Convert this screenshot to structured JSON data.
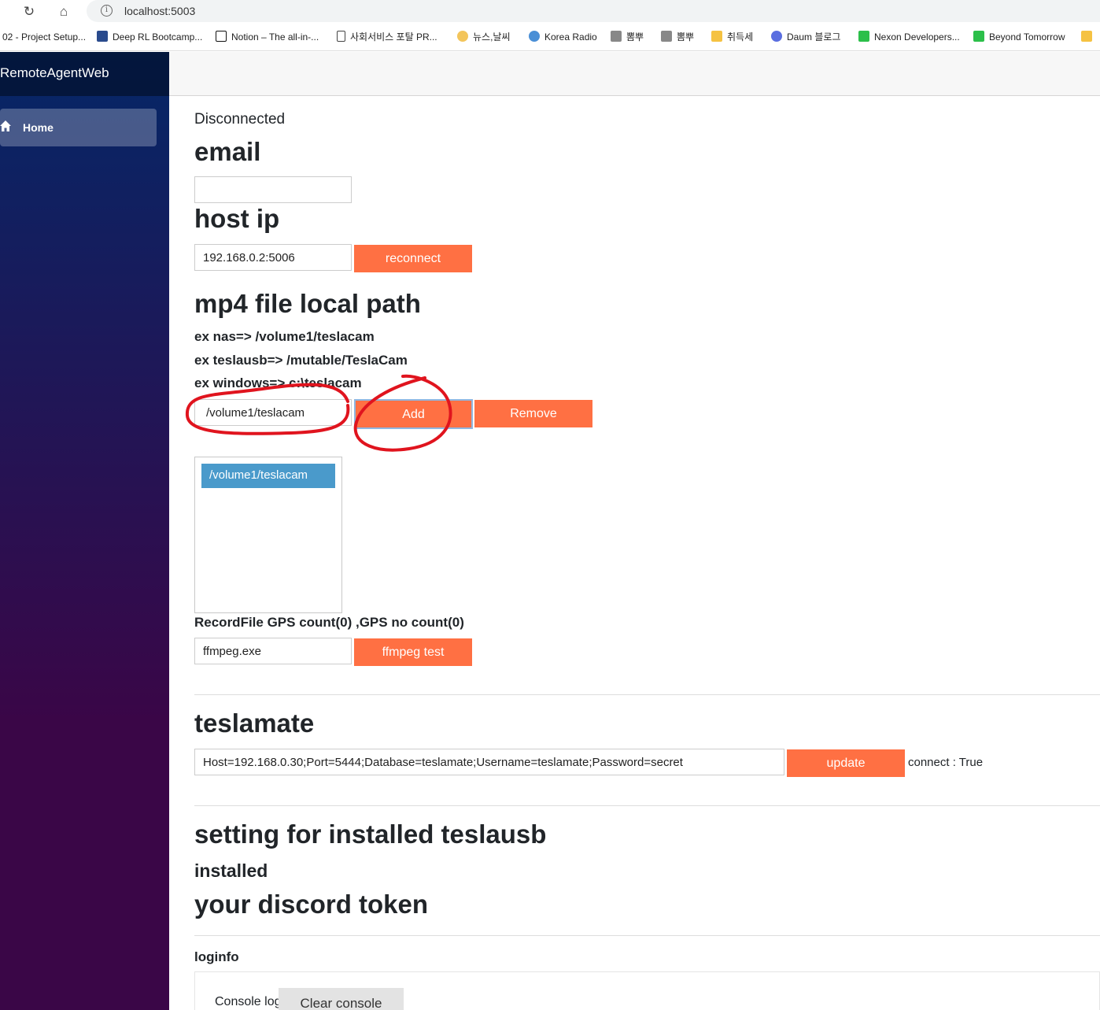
{
  "browser": {
    "url": "localhost:5003",
    "bookmarks": [
      {
        "label": "02 - Project Setup...",
        "icon": "none",
        "color": "#ffffff"
      },
      {
        "label": "Deep RL Bootcamp...",
        "icon": "site-icon",
        "color": "#2a4b8d"
      },
      {
        "label": "Notion – The all-in-...",
        "icon": "notion-icon",
        "color": "#111111"
      },
      {
        "label": "사회서비스 포탈 PR...",
        "icon": "page-icon",
        "color": "#ffffff"
      },
      {
        "label": "뉴스,날씨",
        "icon": "weather-icon",
        "color": "#f3c55b"
      },
      {
        "label": "Korea Radio",
        "icon": "radio-icon",
        "color": "#4a8fd6"
      },
      {
        "label": "뽐뿌",
        "icon": "site-icon",
        "color": "#666666"
      },
      {
        "label": "뽐뿌",
        "icon": "site-icon",
        "color": "#666666"
      },
      {
        "label": "취득세",
        "icon": "folder-icon",
        "color": "#f5c242"
      },
      {
        "label": "Daum 블로그",
        "icon": "daum-icon",
        "color": "#5a6ee0"
      },
      {
        "label": "Nexon Developers...",
        "icon": "chat-icon",
        "color": "#2cbf4a"
      },
      {
        "label": "Beyond Tomorrow",
        "icon": "chat-icon",
        "color": "#2cbf4a"
      },
      {
        "label": "",
        "icon": "folder-icon",
        "color": "#f5c242"
      }
    ]
  },
  "sidebar": {
    "brand": "RemoteAgentWeb",
    "items": [
      {
        "label": "Home",
        "icon": "home-icon"
      }
    ]
  },
  "main": {
    "status": "Disconnected",
    "email": {
      "heading": "email",
      "value": ""
    },
    "host": {
      "heading": "host ip",
      "value": "192.168.0.2:5006",
      "button": "reconnect"
    },
    "mp4": {
      "heading": "mp4 file local path",
      "examples": [
        "ex nas=> /volume1/teslacam",
        "ex teslausb=> /mutable/TeslaCam",
        "ex windows=> c:\\teslacam"
      ],
      "input_value": "/volume1/teslacam",
      "add_button": "Add",
      "remove_button": "Remove",
      "list": [
        "/volume1/teslacam"
      ]
    },
    "record_info": "RecordFile GPS count(0) ,GPS no count(0)",
    "ffmpeg": {
      "value": "ffmpeg.exe",
      "button": "ffmpeg test"
    },
    "teslamate": {
      "heading": "teslamate",
      "value": "Host=192.168.0.30;Port=5444;Database=teslamate;Username=teslamate;Password=secret",
      "button": "update",
      "status": "connect : True"
    },
    "teslausb": {
      "heading": "setting for installed teslausb",
      "status": "installed"
    },
    "discord": {
      "heading": "your discord token"
    },
    "loginfo": {
      "heading": "loginfo",
      "console_label": "Console log",
      "clear_button": "Clear console"
    }
  },
  "colors": {
    "accent": "#ff7043",
    "list_selected": "#4a9acb",
    "annotation": "#e0141e"
  }
}
